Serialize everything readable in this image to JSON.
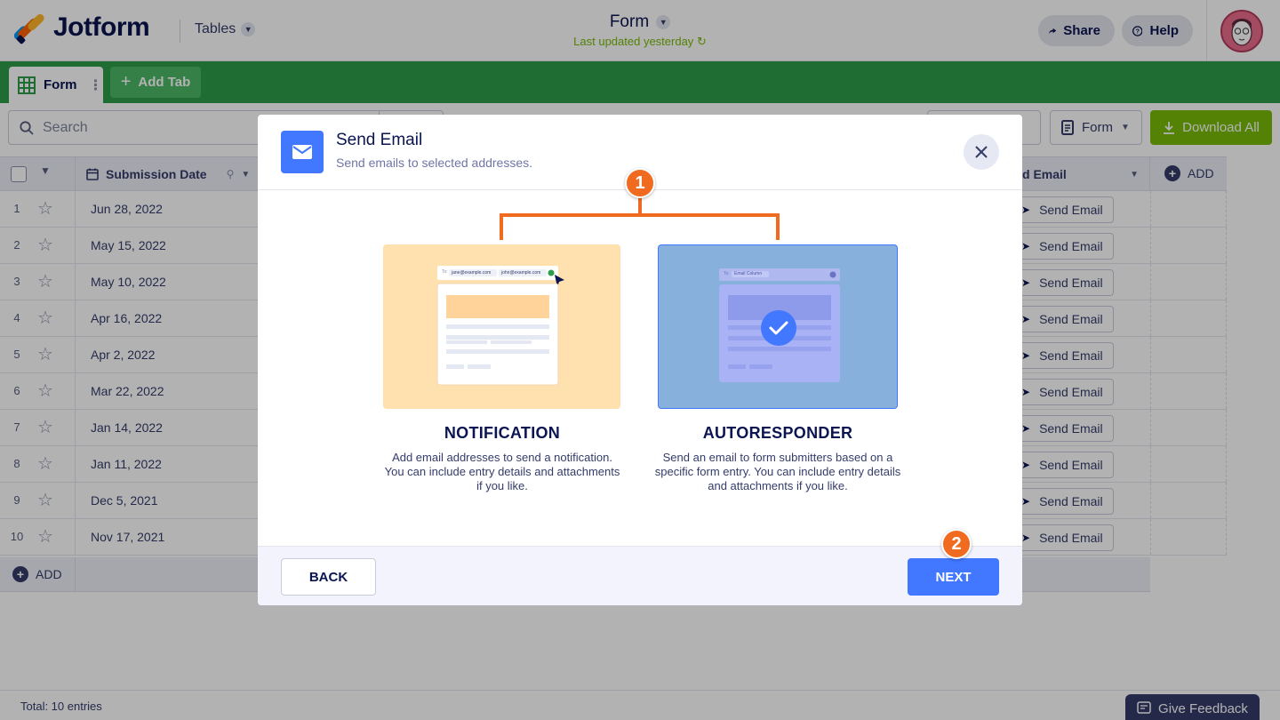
{
  "header": {
    "logo_text": "Jotform",
    "tables_label": "Tables",
    "doc_title": "Form",
    "last_updated": "Last updated yesterday",
    "share_label": "Share",
    "help_label": "Help"
  },
  "tabs": {
    "form_tab": "Form",
    "add_tab": "Add Tab"
  },
  "toolbar": {
    "search_placeholder": "Search",
    "form_select": "Form",
    "download_label": "Download All"
  },
  "grid": {
    "col_submission": "Submission Date",
    "col_send_email": "d Email",
    "add_column": "ADD",
    "add_row": "ADD",
    "rows": [
      {
        "num": "1",
        "date": "Jun 28, 2022",
        "action": "Send Email"
      },
      {
        "num": "2",
        "date": "May 15, 2022",
        "action": "Send Email"
      },
      {
        "num": "3",
        "date": "May 10, 2022",
        "action": "Send Email"
      },
      {
        "num": "4",
        "date": "Apr 16, 2022",
        "action": "Send Email"
      },
      {
        "num": "5",
        "date": "Apr 2, 2022",
        "action": "Send Email"
      },
      {
        "num": "6",
        "date": "Mar 22, 2022",
        "action": "Send Email"
      },
      {
        "num": "7",
        "date": "Jan 14, 2022",
        "action": "Send Email"
      },
      {
        "num": "8",
        "date": "Jan 11, 2022",
        "action": "Send Email"
      },
      {
        "num": "9",
        "date": "Dec 5, 2021",
        "action": "Send Email"
      },
      {
        "num": "10",
        "date": "Nov 17, 2021",
        "action": "Send Email"
      }
    ]
  },
  "status": {
    "total": "Total: 10 entries",
    "feedback": "Give Feedback"
  },
  "modal": {
    "title": "Send Email",
    "subtitle": "Send emails to selected addresses.",
    "notification": {
      "title": "NOTIFICATION",
      "description": "Add email addresses to send a notification. You can include entry details and attachments if you like.",
      "to_label": "To:",
      "email_1": "jane@example.com",
      "email_2": "john@example.com"
    },
    "autoresponder": {
      "title": "AUTORESPONDER",
      "description": "Send an email to form submitters based on a specific form entry. You can include entry details and attachments if you like.",
      "to_label": "To:",
      "email_column": "Email Column"
    },
    "back_label": "BACK",
    "next_label": "NEXT"
  },
  "annotations": {
    "badge_1": "1",
    "badge_2": "2"
  },
  "colors": {
    "brand_green": "#2f9d4a",
    "accent_blue": "#4277ff",
    "annotation_orange": "#f06b1f",
    "download_green": "#78bb07"
  }
}
